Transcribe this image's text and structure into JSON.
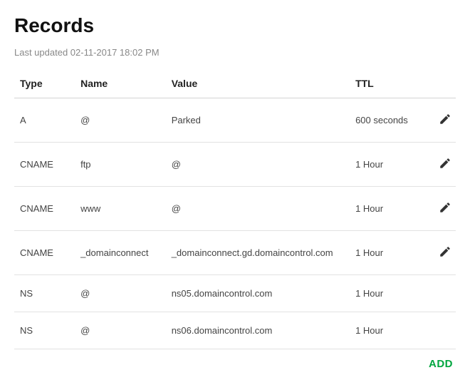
{
  "page": {
    "title": "Records",
    "last_updated_label": "Last updated 02-11-2017 18:02 PM",
    "add_label": "ADD"
  },
  "table": {
    "headers": {
      "type": "Type",
      "name": "Name",
      "value": "Value",
      "ttl": "TTL"
    },
    "rows": [
      {
        "type": "A",
        "name": "@",
        "value": "Parked",
        "ttl": "600 seconds",
        "editable": true
      },
      {
        "type": "CNAME",
        "name": "ftp",
        "value": "@",
        "ttl": "1 Hour",
        "editable": true
      },
      {
        "type": "CNAME",
        "name": "www",
        "value": "@",
        "ttl": "1 Hour",
        "editable": true
      },
      {
        "type": "CNAME",
        "name": "_domainconnect",
        "value": "_domainconnect.gd.domaincontrol.com",
        "ttl": "1 Hour",
        "editable": true
      },
      {
        "type": "NS",
        "name": "@",
        "value": "ns05.domaincontrol.com",
        "ttl": "1 Hour",
        "editable": false
      },
      {
        "type": "NS",
        "name": "@",
        "value": "ns06.domaincontrol.com",
        "ttl": "1 Hour",
        "editable": false
      }
    ]
  }
}
